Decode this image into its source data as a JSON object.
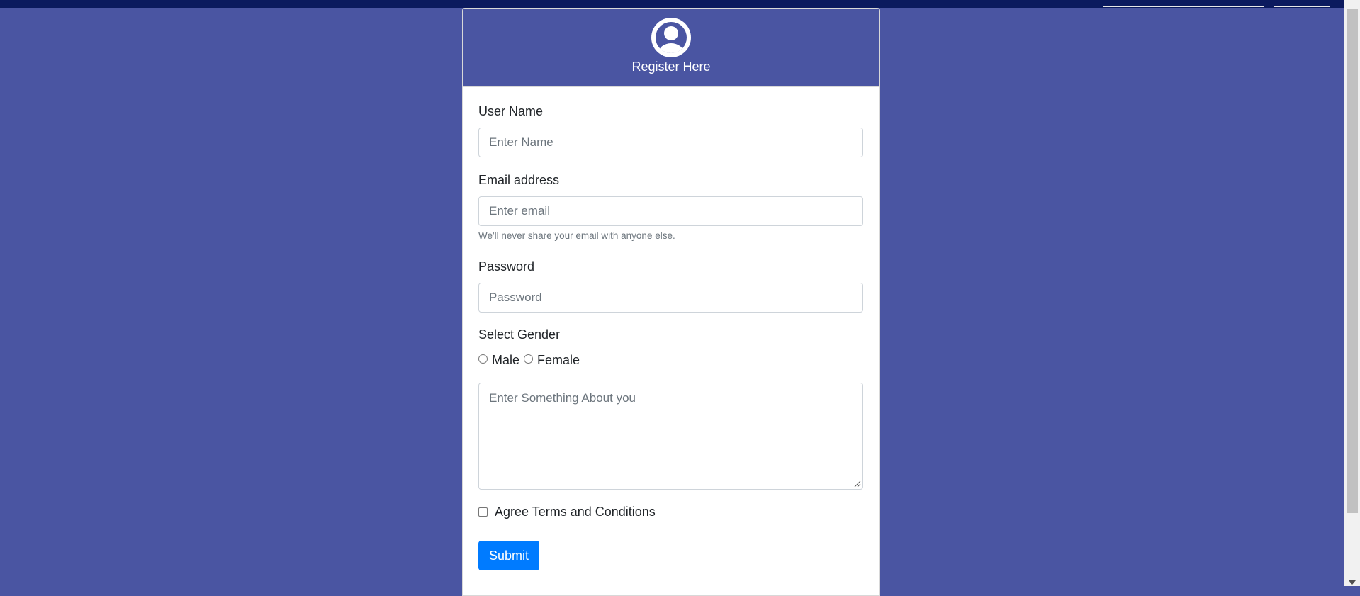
{
  "colors": {
    "page_background": "#4a55a2",
    "topbar": "#0b1a5e",
    "card_header": "#4a55a2",
    "primary_button": "#007bff"
  },
  "header": {
    "icon": "user-circle-icon",
    "title": "Register Here"
  },
  "form": {
    "username": {
      "label": "User Name",
      "placeholder": "Enter Name"
    },
    "email": {
      "label": "Email address",
      "placeholder": "Enter email",
      "help": "We'll never share your email with anyone else."
    },
    "password": {
      "label": "Password",
      "placeholder": "Password"
    },
    "gender": {
      "label": "Select Gender",
      "options": [
        "Male",
        "Female"
      ]
    },
    "about": {
      "placeholder": "Enter Something About you"
    },
    "terms": {
      "label": "Agree Terms and Conditions"
    },
    "submit_label": "Submit"
  }
}
